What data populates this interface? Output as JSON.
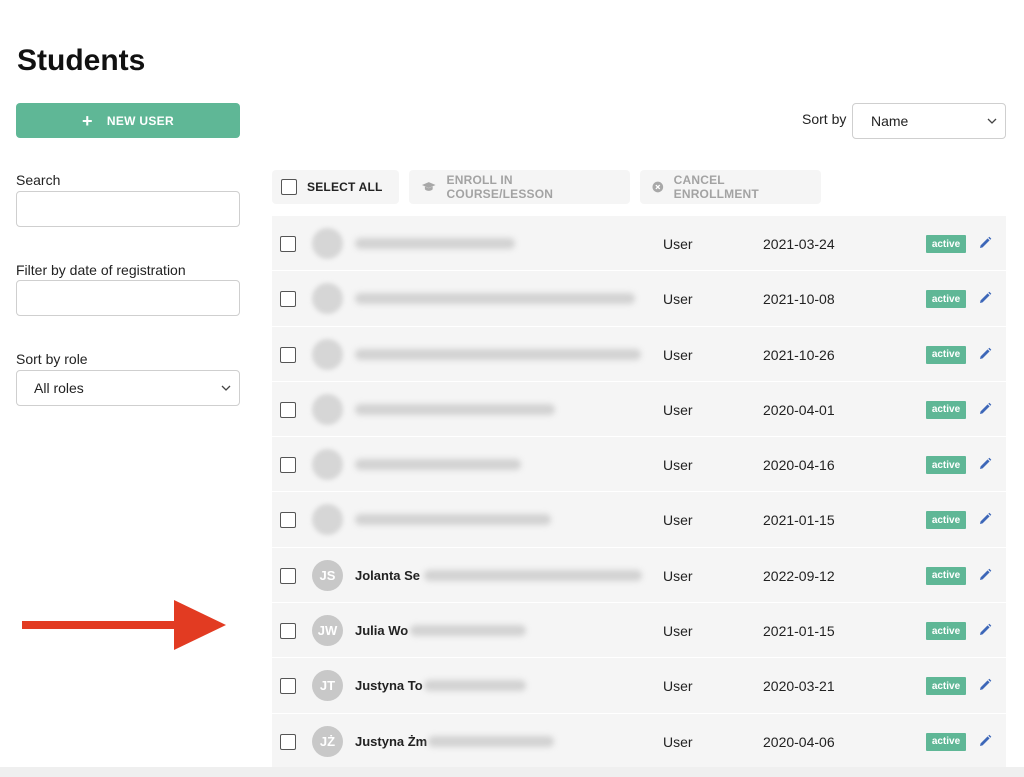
{
  "page": {
    "title": "Students"
  },
  "actions": {
    "new_user": "NEW USER"
  },
  "filters": {
    "search_label": "Search",
    "search_value": "",
    "date_label": "Filter by date of registration",
    "date_value": "",
    "role_label": "Sort by role",
    "role_value": "All roles"
  },
  "sort": {
    "label": "Sort by",
    "value": "Name"
  },
  "bulk": {
    "select_all": "SELECT ALL",
    "enroll": "ENROLL IN COURSE/LESSON",
    "cancel": "CANCEL ENROLLMENT"
  },
  "colors": {
    "accent": "#5fb796",
    "edit": "#3d67b8",
    "arrow": "#e23b22"
  },
  "students": [
    {
      "initials": "",
      "name": "",
      "role": "User",
      "date": "2021-03-24",
      "status": "active"
    },
    {
      "initials": "",
      "name": "",
      "role": "User",
      "date": "2021-10-08",
      "status": "active"
    },
    {
      "initials": "",
      "name": "",
      "role": "User",
      "date": "2021-10-26",
      "status": "active"
    },
    {
      "initials": "",
      "name": "",
      "role": "User",
      "date": "2020-04-01",
      "status": "active"
    },
    {
      "initials": "",
      "name": "",
      "role": "User",
      "date": "2020-04-16",
      "status": "active"
    },
    {
      "initials": "",
      "name": "",
      "role": "User",
      "date": "2021-01-15",
      "status": "active"
    },
    {
      "initials": "JS",
      "name": "Jolanta Se",
      "role": "User",
      "date": "2022-09-12",
      "status": "active"
    },
    {
      "initials": "JW",
      "name": "Julia Wo",
      "role": "User",
      "date": "2021-01-15",
      "status": "active"
    },
    {
      "initials": "JT",
      "name": "Justyna To",
      "role": "User",
      "date": "2020-03-21",
      "status": "active"
    },
    {
      "initials": "JŻ",
      "name": "Justyna Żm",
      "role": "User",
      "date": "2020-04-06",
      "status": "active"
    }
  ]
}
